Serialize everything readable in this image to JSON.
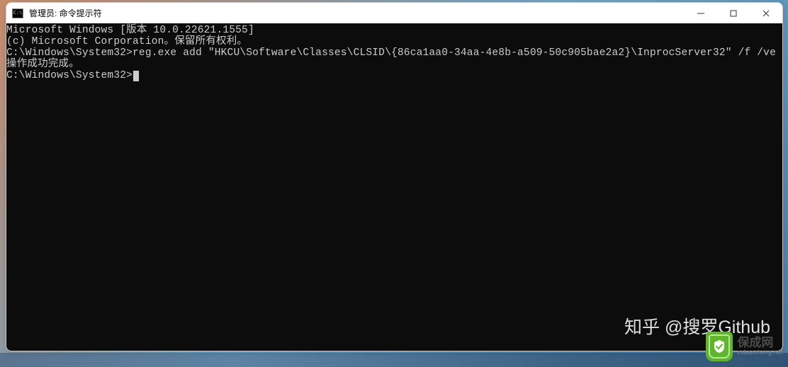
{
  "window": {
    "title": "管理员: 命令提示符",
    "icon_label": "C:\\"
  },
  "terminal": {
    "lines": [
      "Microsoft Windows [版本 10.0.22621.1555]",
      "(c) Microsoft Corporation。保留所有权利。",
      "",
      "C:\\Windows\\System32>reg.exe add \"HKCU\\Software\\Classes\\CLSID\\{86ca1aa0-34aa-4e8b-a509-50c905bae2a2}\\InprocServer32\" /f /ve",
      "操作成功完成。",
      ""
    ],
    "prompt": "C:\\Windows\\System32>"
  },
  "watermarks": {
    "zhihu": "知乎 @搜罗Github",
    "logo_main": "保成网",
    "logo_sub": "zsbaocheng.net"
  }
}
